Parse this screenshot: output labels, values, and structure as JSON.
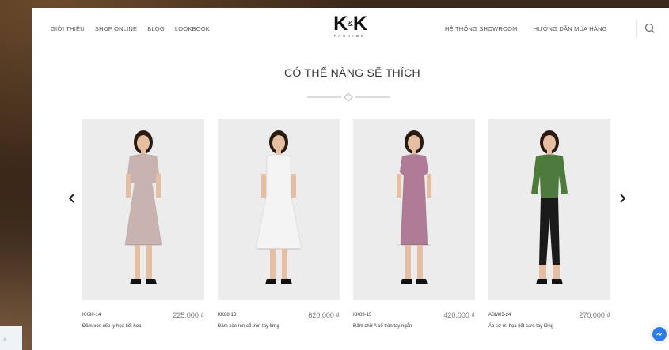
{
  "nav": {
    "left": [
      "GIỚI THIỆU",
      "SHOP ONLINE",
      "BLOG",
      "LOOKBOOK"
    ],
    "right": [
      "HỆ THỐNG SHOWROOM",
      "HƯỚNG DẪN MUA HÀNG"
    ]
  },
  "logo": {
    "left": "K",
    "amp": "&",
    "right": "K",
    "sub": "FASHION"
  },
  "section": {
    "title": "CÓ THỂ NÀNG SẼ THÍCH"
  },
  "icons": {
    "search": "search-icon",
    "prev": "chevron-left-icon",
    "next": "chevron-right-icon",
    "chat": "messenger-icon"
  },
  "products": [
    {
      "code": "KK90-14",
      "price": "225.000 ₫",
      "name": "Đầm xòe xếp ly họa tiết hoa",
      "dress_color": "#c9b3b0",
      "style": "floral-pleated"
    },
    {
      "code": "KK88-13",
      "price": "620.000 ₫",
      "name": "Đầm xòe ren cổ tròn tay lửng",
      "dress_color": "#f4f4f4",
      "style": "lace"
    },
    {
      "code": "KK89-15",
      "price": "420.000 ₫",
      "name": "Đầm chữ A cổ tròn tay ngắn",
      "dress_color": "#b07b97",
      "style": "a-line"
    },
    {
      "code": "ASM03-24",
      "price": "270.000 ₫",
      "name": "Áo sơ mi họa tiết caro tay lửng",
      "dress_color": "#4f7a3d",
      "style": "shirt-pants"
    }
  ],
  "floating": {
    "left_tab": "»"
  }
}
